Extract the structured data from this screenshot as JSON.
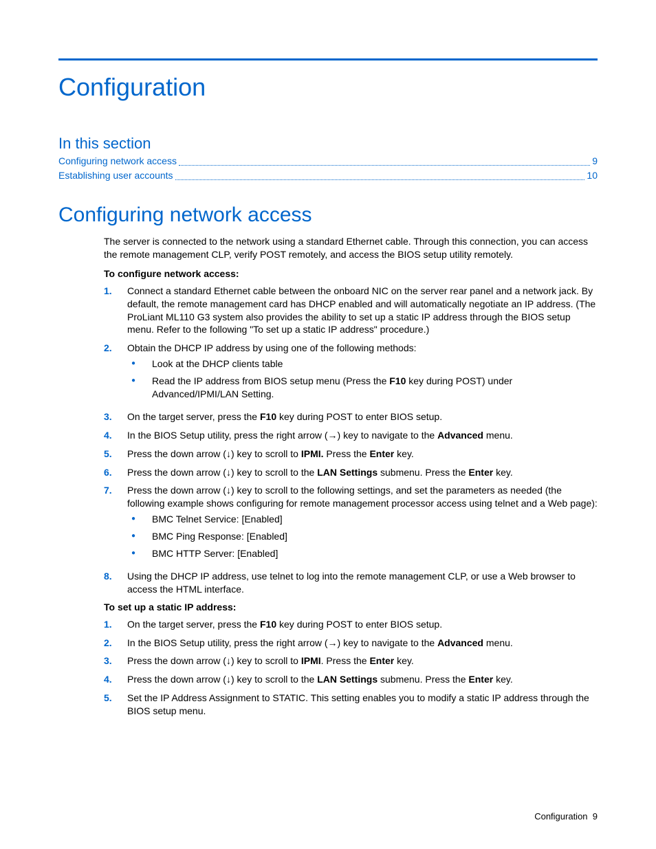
{
  "title": "Configuration",
  "section_label": "In this section",
  "toc": [
    {
      "label": "Configuring network access",
      "page": "9"
    },
    {
      "label": "Establishing user accounts",
      "page": "10"
    }
  ],
  "h2": "Configuring network access",
  "intro": "The server is connected to the network using a standard Ethernet cable. Through this connection, you can access the remote management CLP, verify POST remotely, and access the BIOS setup utility remotely.",
  "lead1": "To configure network access:",
  "steps1": {
    "s1": "Connect a standard Ethernet cable between the onboard NIC on the server rear panel and a network jack. By default, the remote management card has DHCP enabled and will automatically negotiate an IP address. (The ProLiant ML110 G3 system also provides the ability to set up a static IP address through the BIOS setup menu. Refer to the following \"To set up a static IP address\" procedure.)",
    "s2": "Obtain the DHCP IP address by using one of the following methods:",
    "s2_b1": "Look at the DHCP clients table",
    "s2_b2a": "Read the IP address from BIOS setup menu (Press the ",
    "s2_b2b": "F10",
    "s2_b2c": " key during POST) under Advanced/IPMI/LAN Setting.",
    "s3a": "On the target server, press the ",
    "s3b": "F10",
    "s3c": " key during POST to enter BIOS setup.",
    "s4a": "In the BIOS Setup utility, press the right arrow (→) key to navigate to the ",
    "s4b": "Advanced",
    "s4c": " menu.",
    "s5a": "Press the down arrow (↓) key to scroll to ",
    "s5b": "IPMI.",
    "s5c": " Press the ",
    "s5d": "Enter",
    "s5e": " key.",
    "s6a": "Press the down arrow (↓) key to scroll to the ",
    "s6b": "LAN Settings",
    "s6c": " submenu. Press the ",
    "s6d": "Enter",
    "s6e": " key.",
    "s7": "Press the down arrow (↓) key to scroll to the following settings, and set the parameters as needed (the following example shows configuring for remote management processor access using telnet and a Web page):",
    "s7_b1": "BMC Telnet Service: [Enabled]",
    "s7_b2": "BMC Ping Response: [Enabled]",
    "s7_b3": "BMC HTTP Server: [Enabled]",
    "s8": "Using the DHCP IP address, use telnet to log into the remote management CLP, or use a Web browser to access the HTML interface."
  },
  "lead2": "To set up a static IP address:",
  "steps2": {
    "s1a": "On the target server, press the ",
    "s1b": "F10",
    "s1c": " key during POST to enter BIOS setup.",
    "s2a": "In the BIOS Setup utility, press the right arrow (→) key to navigate to the ",
    "s2b": "Advanced",
    "s2c": " menu.",
    "s3a": "Press the down arrow (↓) key to scroll to ",
    "s3b": "IPMI",
    "s3c": ". Press the ",
    "s3d": "Enter",
    "s3e": " key.",
    "s4a": "Press the down arrow (↓) key to scroll to the ",
    "s4b": "LAN Settings",
    "s4c": " submenu. Press the ",
    "s4d": "Enter",
    "s4e": " key.",
    "s5": "Set the IP Address Assignment to STATIC. This setting enables you to modify a static IP address through the BIOS setup menu."
  },
  "footer": {
    "label": "Configuration",
    "page": "9"
  },
  "nums": {
    "n1": "1.",
    "n2": "2.",
    "n3": "3.",
    "n4": "4.",
    "n5": "5.",
    "n6": "6.",
    "n7": "7.",
    "n8": "8."
  }
}
